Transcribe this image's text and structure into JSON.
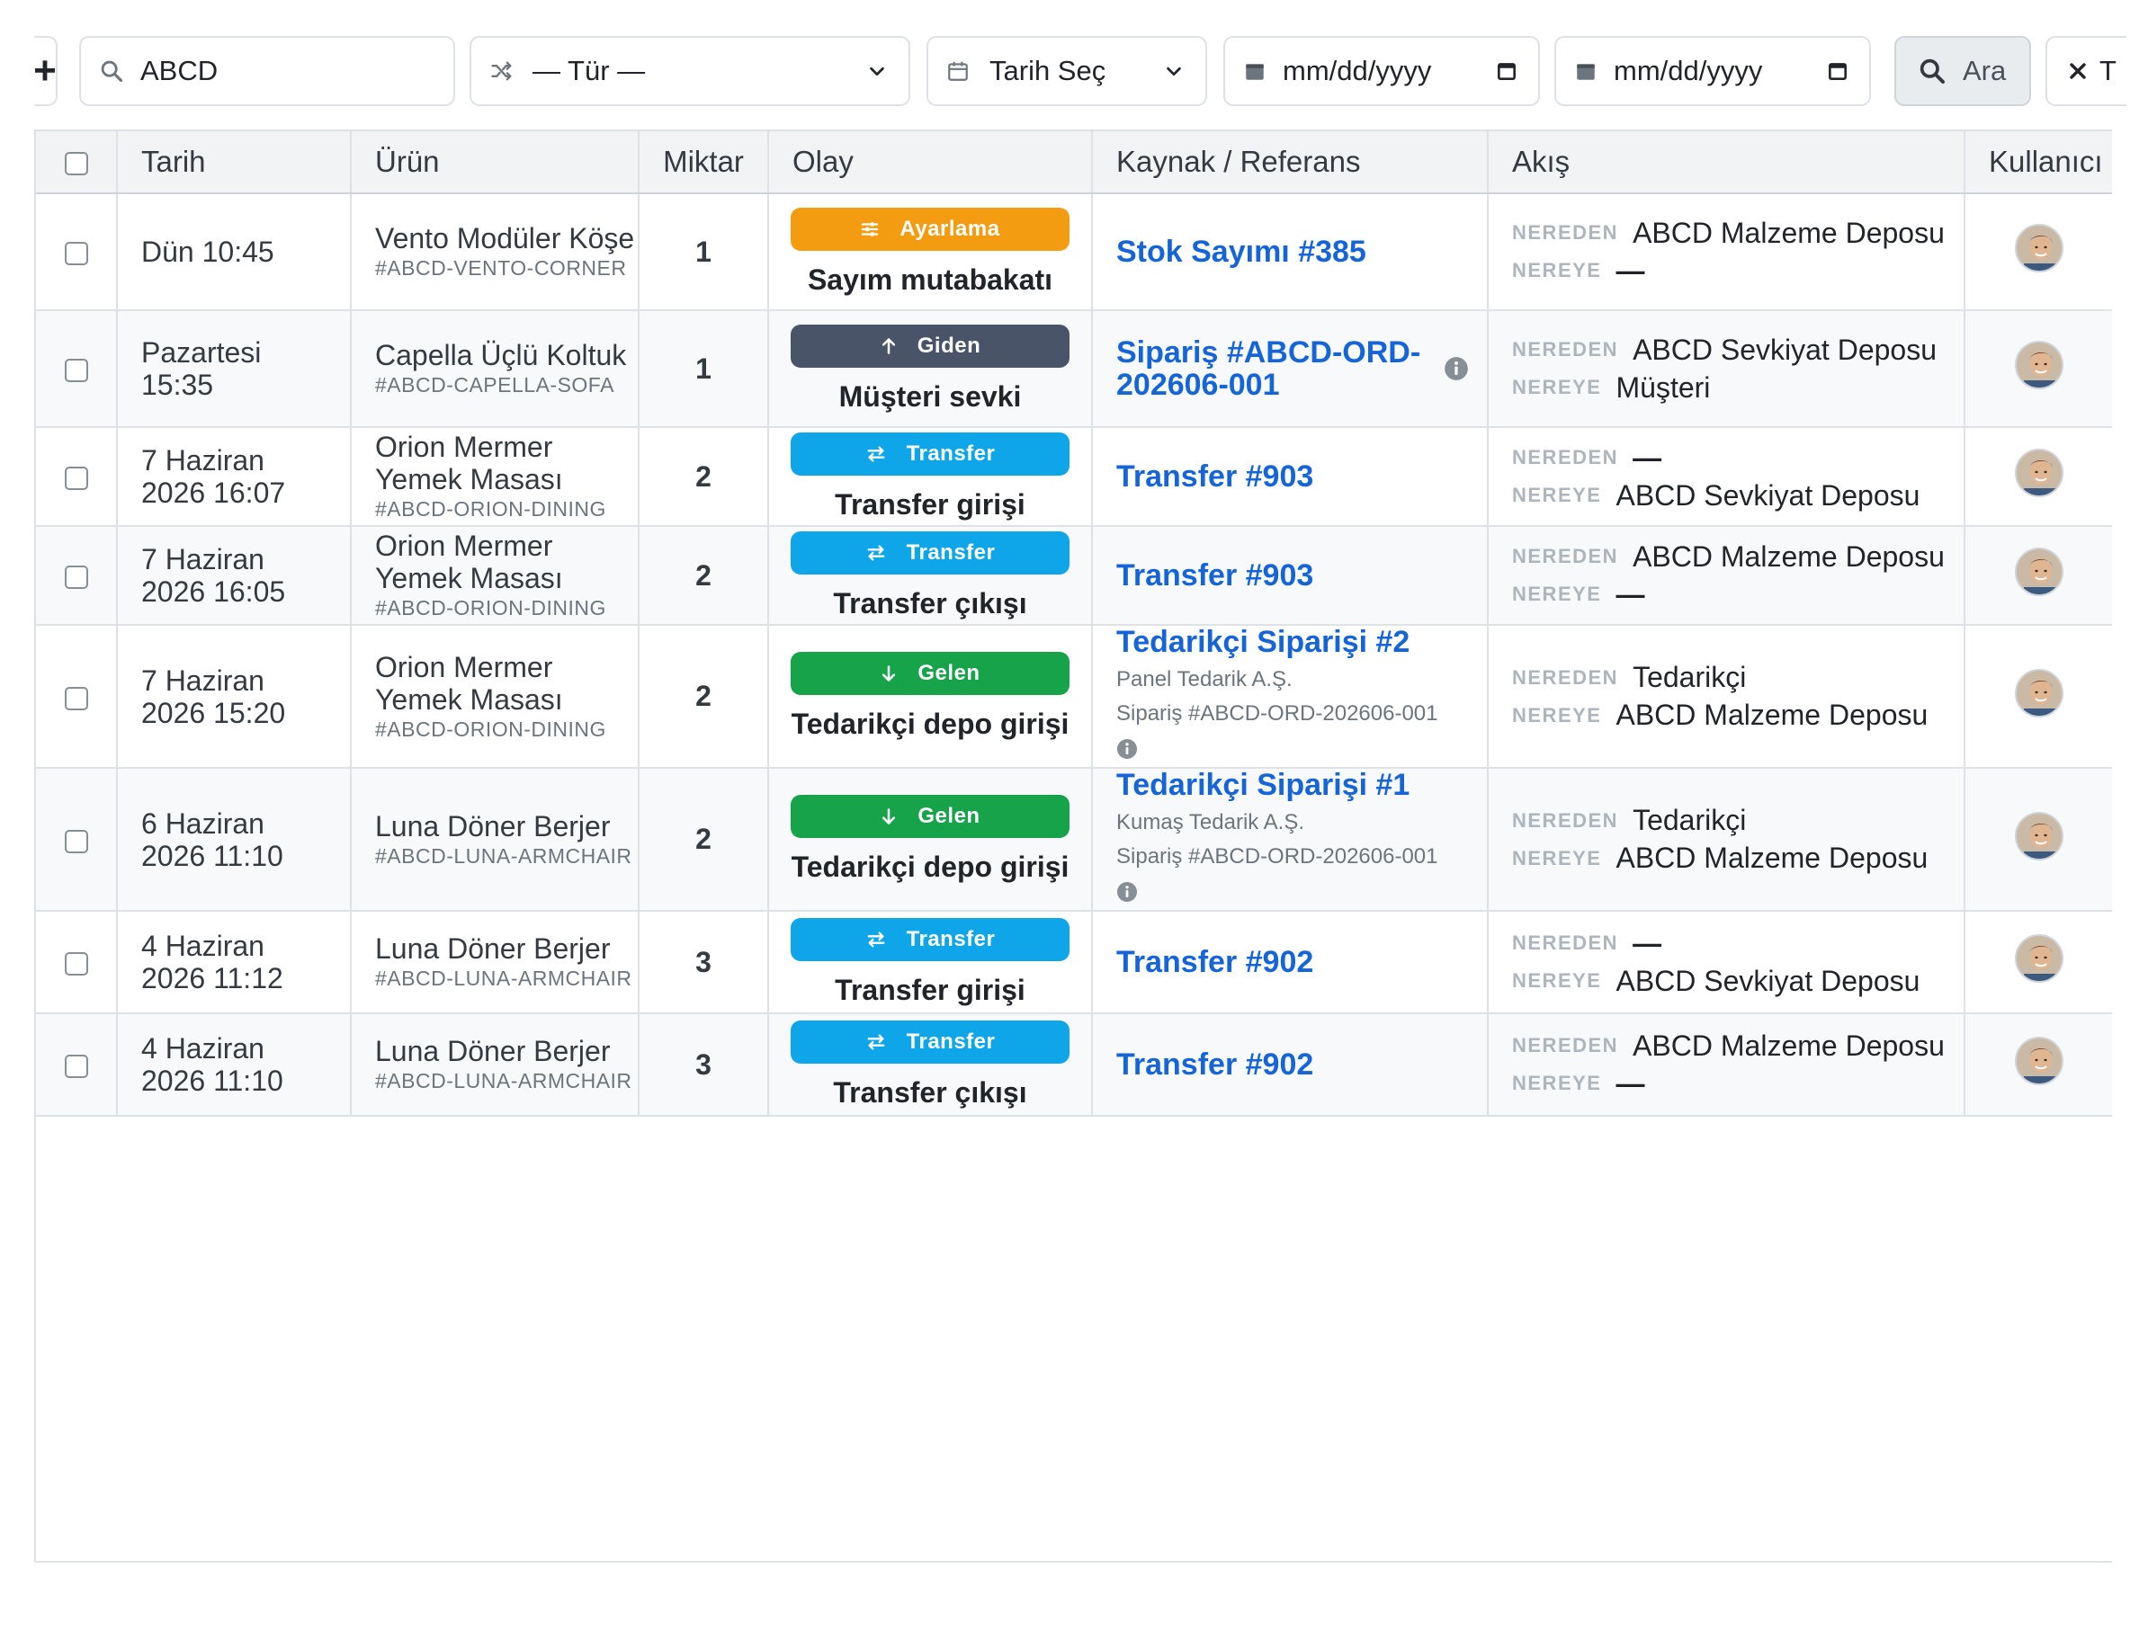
{
  "toolbar": {
    "add_label": "+",
    "search_value": "ABCD",
    "type_placeholder": "— Tür —",
    "date_select": "Tarih Seç",
    "date_from": "mm/dd/yyyy",
    "date_to": "mm/dd/yyyy",
    "search_button": "Ara",
    "clear_button": "T"
  },
  "table": {
    "headers": [
      "Tarih",
      "Ürün",
      "Miktar",
      "Olay",
      "Kaynak / Referans",
      "Akış",
      "Kullanıcı"
    ],
    "flow_from_label": "NEREDEN",
    "flow_to_label": "NEREYE",
    "rows": [
      {
        "date": "Dün 10:45",
        "product": "Vento Modüler Köşe",
        "sku": "#ABCD-VENTO-CORNER",
        "qty": "1",
        "badge": "Ayarlama",
        "badge_kind": "adjust",
        "event": "Sayım mutabakatı",
        "ref": "Stok Sayımı #385",
        "from": "ABCD Malzeme Deposu",
        "to": "—"
      },
      {
        "date": "Pazartesi 15:35",
        "product": "Capella Üçlü Koltuk",
        "sku": "#ABCD-CAPELLA-SOFA",
        "qty": "1",
        "badge": "Giden",
        "badge_kind": "out",
        "event": "Müşteri sevki",
        "ref": "Sipariş #ABCD-ORD-202606-001",
        "from": "ABCD Sevkiyat Deposu",
        "to": "Müşteri"
      },
      {
        "date": "7 Haziran 2026 16:07",
        "product": "Orion Mermer Yemek Masası",
        "sku": "#ABCD-ORION-DINING",
        "qty": "2",
        "badge": "Transfer",
        "badge_kind": "transfer",
        "event": "Transfer girişi",
        "ref": "Transfer #903",
        "from": "—",
        "to": "ABCD Sevkiyat Deposu"
      },
      {
        "date": "7 Haziran 2026 16:05",
        "product": "Orion Mermer Yemek Masası",
        "sku": "#ABCD-ORION-DINING",
        "qty": "2",
        "badge": "Transfer",
        "badge_kind": "transfer",
        "event": "Transfer çıkışı",
        "ref": "Transfer #903",
        "from": "ABCD Malzeme Deposu",
        "to": "—"
      },
      {
        "date": "7 Haziran 2026 15:20",
        "product": "Orion Mermer Yemek Masası",
        "sku": "#ABCD-ORION-DINING",
        "qty": "2",
        "badge": "Gelen",
        "badge_kind": "in",
        "event": "Tedarikçi depo girişi",
        "ref": "Tedarikçi Siparişi #2",
        "ref_supplier": "Panel Tedarik A.Ş.",
        "ref_order": "Sipariş #ABCD-ORD-202606-001",
        "from": "Tedarikçi",
        "to": "ABCD Malzeme Deposu"
      },
      {
        "date": "6 Haziran 2026 11:10",
        "product": "Luna Döner Berjer",
        "sku": "#ABCD-LUNA-ARMCHAIR",
        "qty": "2",
        "badge": "Gelen",
        "badge_kind": "in",
        "event": "Tedarikçi depo girişi",
        "ref": "Tedarikçi Siparişi #1",
        "ref_supplier": "Kumaş Tedarik A.Ş.",
        "ref_order": "Sipariş #ABCD-ORD-202606-001",
        "from": "Tedarikçi",
        "to": "ABCD Malzeme Deposu"
      },
      {
        "date": "4 Haziran 2026 11:12",
        "product": "Luna Döner Berjer",
        "sku": "#ABCD-LUNA-ARMCHAIR",
        "qty": "3",
        "badge": "Transfer",
        "badge_kind": "transfer",
        "event": "Transfer girişi",
        "ref": "Transfer #902",
        "from": "—",
        "to": "ABCD Sevkiyat Deposu"
      },
      {
        "date": "4 Haziran 2026 11:10",
        "product": "Luna Döner Berjer",
        "sku": "#ABCD-LUNA-ARMCHAIR",
        "qty": "3",
        "badge": "Transfer",
        "badge_kind": "transfer",
        "event": "Transfer çıkışı",
        "ref": "Transfer #902",
        "from": "ABCD Malzeme Deposu",
        "to": "—"
      }
    ]
  },
  "colors": {
    "adjust": "#f39c12",
    "out": "#495468",
    "transfer": "#0ea5e9",
    "in": "#16a34a",
    "link": "#1565d8"
  },
  "icons": {
    "search": "search-icon",
    "type": "shuffle-icon",
    "calendar": "calendar-icon",
    "chevron": "chevron-down-icon",
    "clear": "close-icon",
    "info": "info-icon",
    "avatar": "avatar"
  }
}
